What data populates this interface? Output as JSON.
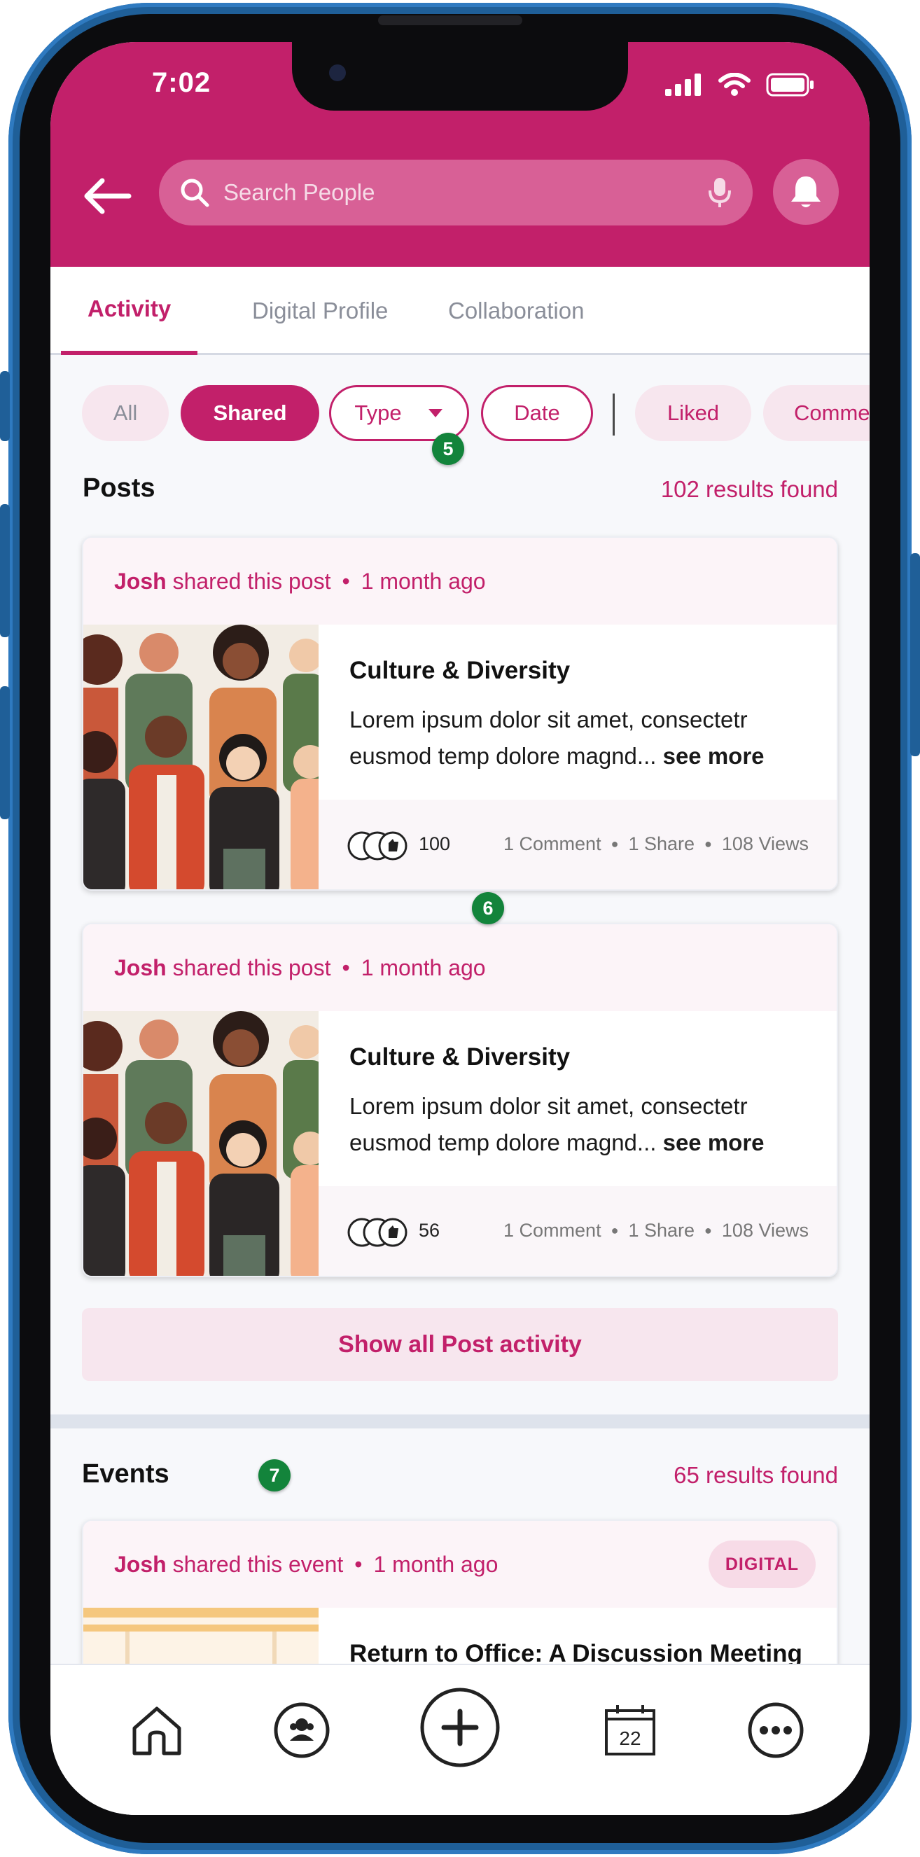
{
  "status_bar": {
    "time": "7:02"
  },
  "search": {
    "placeholder": "Search People"
  },
  "tabs": [
    {
      "label": "Activity",
      "active": true
    },
    {
      "label": "Digital Profile",
      "active": false
    },
    {
      "label": "Collaboration",
      "active": false
    }
  ],
  "filters": {
    "all": "All",
    "shared": "Shared",
    "type": "Type",
    "date": "Date",
    "liked": "Liked",
    "comments": "Comme"
  },
  "markers": {
    "m5": "5",
    "m6": "6",
    "m7": "7"
  },
  "posts": {
    "title": "Posts",
    "results": "102 results found",
    "items": [
      {
        "author": "Josh",
        "action": "shared this post",
        "time": "1 month ago",
        "title": "Culture & Diversity",
        "body": "Lorem ipsum dolor sit amet, consectetr eusmod temp dolore magnd...",
        "see_more": "see more",
        "reactions": "100",
        "comments": "1 Comment",
        "shares": "1 Share",
        "views": "108 Views"
      },
      {
        "author": "Josh",
        "action": "shared this post",
        "time": "1 month ago",
        "title": "Culture & Diversity",
        "body": "Lorem ipsum dolor sit amet, consectetr eusmod temp dolore magnd...",
        "see_more": "see more",
        "reactions": "56",
        "comments": "1 Comment",
        "shares": "1 Share",
        "views": "108 Views"
      }
    ],
    "show_all": "Show all Post activity"
  },
  "events": {
    "title": "Events",
    "results": "65 results found",
    "item": {
      "author": "Josh",
      "action": "shared this event",
      "time": "1 month ago",
      "tag": "DIGITAL",
      "title": "Return to Office: A Discussion Meeting"
    }
  },
  "bottom_nav": {
    "calendar_day": "22"
  },
  "colors": {
    "brand": "#c2206a",
    "marker": "#13843b"
  }
}
